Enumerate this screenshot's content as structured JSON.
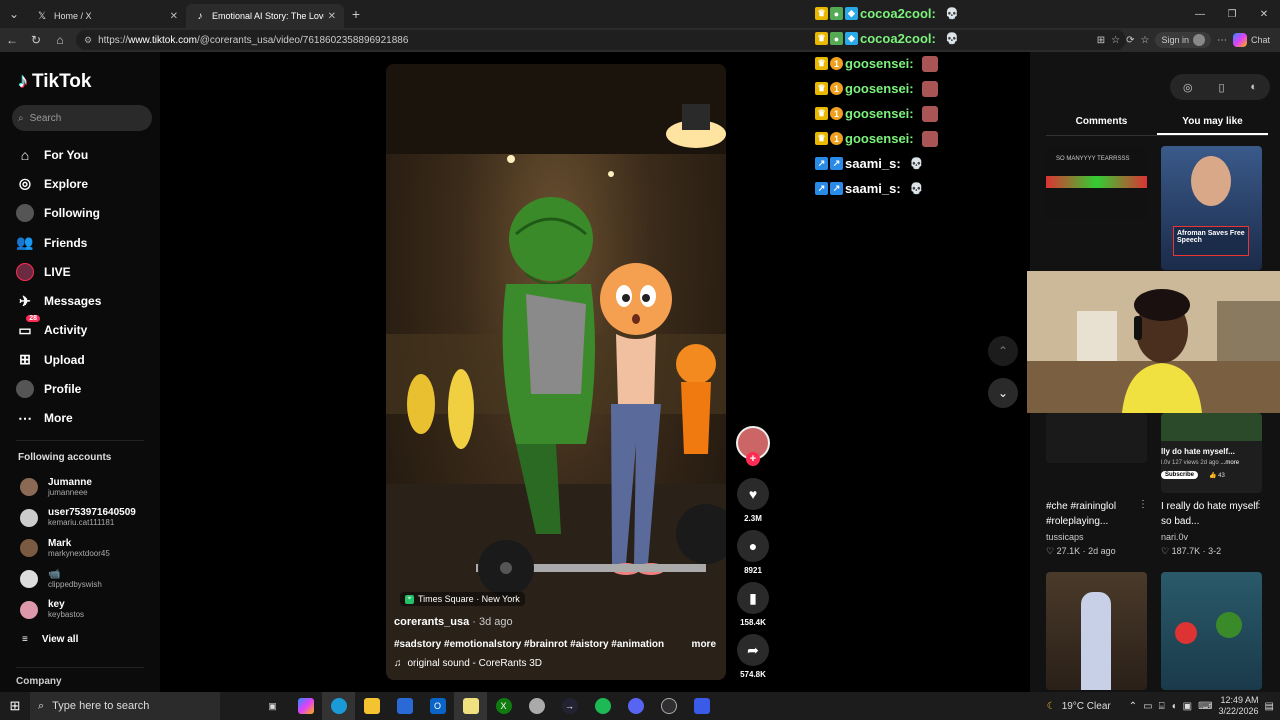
{
  "browser": {
    "tabs": [
      {
        "label": "Home / X",
        "icon": "x-logo-icon"
      },
      {
        "label": "Emotional AI Story: The Love Note",
        "icon": "tiktok-icon"
      }
    ],
    "url_scheme": "https://",
    "url_host": "www.tiktok.com",
    "url_path": "/@corerants_usa/video/7618602358896921886",
    "signin_label": "Sign in",
    "chat_label": "Chat"
  },
  "sidebar": {
    "logo": "TikTok",
    "search_placeholder": "Search",
    "nav": [
      {
        "label": "For You",
        "icon": "home-icon"
      },
      {
        "label": "Explore",
        "icon": "compass-icon"
      },
      {
        "label": "Following",
        "icon": "following-avatar-icon"
      },
      {
        "label": "Friends",
        "icon": "friends-icon"
      },
      {
        "label": "LIVE",
        "icon": "live-icon"
      },
      {
        "label": "Messages",
        "icon": "messages-icon"
      },
      {
        "label": "Activity",
        "icon": "activity-icon",
        "badge": "28"
      },
      {
        "label": "Upload",
        "icon": "upload-icon"
      },
      {
        "label": "Profile",
        "icon": "profile-icon"
      },
      {
        "label": "More",
        "icon": "more-icon"
      }
    ],
    "following_title": "Following accounts",
    "accounts": [
      {
        "name": "Jumanne",
        "handle": "jumanneee"
      },
      {
        "name": "user753971640509",
        "handle": "kemariu.cat111181"
      },
      {
        "name": "Mark",
        "handle": "markynextdoor45"
      },
      {
        "name": "📹",
        "handle": "clippedbyswish"
      },
      {
        "name": "key",
        "handle": "keybastos"
      }
    ],
    "view_all": "View all",
    "company": "Company"
  },
  "video": {
    "location": "Times Square · New York",
    "author": "corerants_usa",
    "ago": " · 3d ago",
    "tags": "#sadstory #emotionalstory #brainrot #aistory #animation",
    "more": "more",
    "sound": "original sound - CoreRants 3D",
    "likes": "2.3M",
    "comments": "8921",
    "saves": "158.4K",
    "shares": "574.8K"
  },
  "chat": [
    {
      "user": "cocoa2cool:",
      "color": "#7cf27c"
    },
    {
      "user": "cocoa2cool:",
      "color": "#7cf27c"
    },
    {
      "user": "goosensei:",
      "color": "#7cf27c"
    },
    {
      "user": "goosensei:",
      "color": "#7cf27c"
    },
    {
      "user": "goosensei:",
      "color": "#7cf27c"
    },
    {
      "user": "goosensei:",
      "color": "#7cf27c"
    },
    {
      "user": "saami_s:",
      "color": "#ffffff"
    },
    {
      "user": "saami_s:",
      "color": "#ffffff"
    }
  ],
  "right_panel": {
    "tabs": [
      "Comments",
      "You may like"
    ],
    "cards": [
      {
        "thumb_text": "SO MANYYYY TEARRSSS"
      },
      {
        "thumb_text": "Afroman Saves Free Speech"
      },
      {
        "title": "#che #raininglol #roleplaying...",
        "user": "tussicaps",
        "meta": "27.1K · 2d ago"
      },
      {
        "thumb_text": "lly do hate myself...",
        "title": "I really do hate myself so bad...",
        "user": "nari.0v",
        "meta": "187.7K · 3-2",
        "subscribe": "Subscribe",
        "likes_small": "43",
        "views_small": "l.0v 127 views 2d ago",
        "more_small": "...more"
      }
    ]
  },
  "taskbar": {
    "search_placeholder": "Type here to search",
    "weather": "19°C  Clear",
    "time": "12:49 AM",
    "date": "3/22/2026"
  },
  "colors": {
    "tiktok_red": "#fe2c55",
    "tiktok_cyan": "#25f4ee"
  }
}
